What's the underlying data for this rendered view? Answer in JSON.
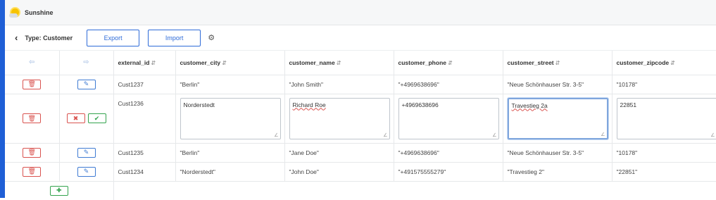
{
  "app": {
    "title": "Sunshine"
  },
  "toolbar": {
    "back_icon": "chevron-left-icon",
    "type_title": "Type: Customer",
    "export_label": "Export",
    "import_label": "Import",
    "settings_icon": "gear-icon"
  },
  "table": {
    "columns": [
      "external_id",
      "customer_city",
      "customer_name",
      "customer_phone",
      "customer_street",
      "customer_zipcode"
    ],
    "rows": [
      {
        "external_id": "Cust1237",
        "customer_city": "\"Berlin\"",
        "customer_name": "\"John Smith\"",
        "customer_phone": "\"+4969638696\"",
        "customer_street": "\"Neue Schönhauser Str. 3-5\"",
        "customer_zipcode": "\"10178\""
      }
    ],
    "editing_row": {
      "external_id": "Cust1236",
      "customer_city": "Norderstedt",
      "customer_name": "Richard Roe",
      "customer_phone": "+4969638696",
      "customer_street": "Travestieg 2a",
      "customer_zipcode": "22851"
    },
    "rows_after": [
      {
        "external_id": "Cust1235",
        "customer_city": "\"Berlin\"",
        "customer_name": "\"Jane Doe\"",
        "customer_phone": "\"+4969638696\"",
        "customer_street": "\"Neue Schönhauser Str. 3-5\"",
        "customer_zipcode": "\"10178\""
      },
      {
        "external_id": "Cust1234",
        "customer_city": "\"Norderstedt\"",
        "customer_name": "\"John Doe\"",
        "customer_phone": "\"+491575555279\"",
        "customer_street": "\"Travestieg 2\"",
        "customer_zipcode": "\"22851\""
      }
    ]
  },
  "colors": {
    "primary": "#2e6bd8",
    "danger": "#d9534f",
    "success": "#33a34e",
    "left_strip": "#1f5fd6"
  }
}
